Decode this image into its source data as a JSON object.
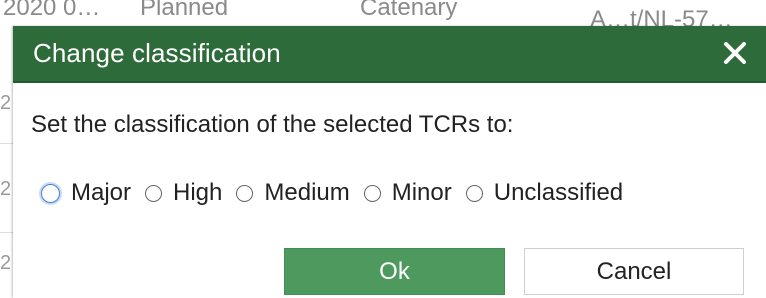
{
  "background": {
    "row_cells": [
      "2020 0…",
      "Planned",
      "Catenary",
      "A…t/NL-57…"
    ],
    "edge_digits": [
      "2",
      "2",
      "2",
      "2"
    ]
  },
  "dialog": {
    "title": "Change classification",
    "prompt": "Set the classification of the selected TCRs to:",
    "options": [
      {
        "label": "Major",
        "selected": false,
        "focused": true
      },
      {
        "label": "High",
        "selected": false
      },
      {
        "label": "Medium",
        "selected": false
      },
      {
        "label": "Minor",
        "selected": false
      },
      {
        "label": "Unclassified",
        "selected": false
      }
    ],
    "ok_label": "Ok",
    "cancel_label": "Cancel"
  },
  "colors": {
    "titlebar": "#2e6b3b",
    "ok_button": "#4e9a5e",
    "focus_ring": "#4a7fd8"
  },
  "icons": {
    "close": "close-icon",
    "radio": "radio-icon"
  }
}
